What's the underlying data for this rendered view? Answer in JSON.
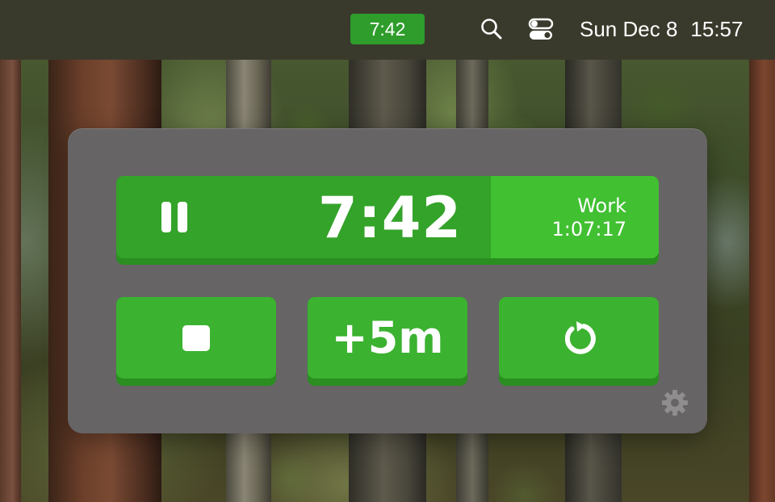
{
  "menubar": {
    "timer_badge": "7:42",
    "search_icon": "search-icon",
    "control_icon": "control-center-icon",
    "date": "Sun Dec 8",
    "time": "15:57",
    "timer_badge_color": "#2e9d2b"
  },
  "popover": {
    "timer": {
      "state_icon": "pause-icon",
      "remaining": "7:42",
      "session_label": "Work",
      "session_total": "1:07:17"
    },
    "buttons": {
      "stop_icon": "stop-icon",
      "add_label": "+5m",
      "reset_icon": "reset-icon"
    },
    "settings_icon": "gear-icon",
    "colors": {
      "accent": "#3bb230",
      "accent_dark": "#2a8e21",
      "accent_light": "#41c032",
      "panel": "#666465"
    }
  }
}
